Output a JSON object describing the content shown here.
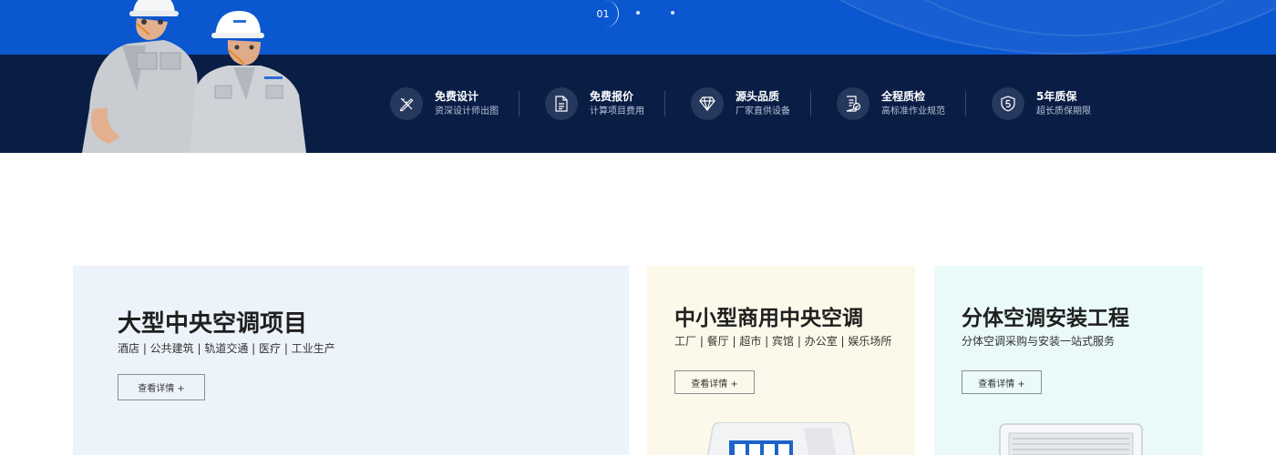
{
  "hero": {
    "slide_current": "01"
  },
  "features": [
    {
      "icon": "pen-ruler-icon",
      "title": "免费设计",
      "subtitle": "资深设计师出图"
    },
    {
      "icon": "document-icon",
      "title": "免费报价",
      "subtitle": "计算项目费用"
    },
    {
      "icon": "diamond-icon",
      "title": "源头品质",
      "subtitle": "厂家直供设备"
    },
    {
      "icon": "checklist-icon",
      "title": "全程质检",
      "subtitle": "高标准作业规范"
    },
    {
      "icon": "shield-5-icon",
      "title": "5年质保",
      "subtitle": "超长质保期限"
    }
  ],
  "cards": [
    {
      "title": "大型中央空调项目",
      "subtitle": "酒店 | 公共建筑 | 轨道交通 | 医疗 | 工业生产",
      "button": "查看详情 +",
      "background": "#edf3fb"
    },
    {
      "title": "中小型商用中央空调",
      "subtitle": "工厂 | 餐厅 | 超市 | 宾馆 | 办公室 | 娱乐场所",
      "button": "查看详情 +",
      "background": "#fdf9ea"
    },
    {
      "title": "分体空调安装工程",
      "subtitle": "分体空调采购与安装一站式服务",
      "button": "查看详情 +",
      "background": "#e9faf8"
    }
  ],
  "colors": {
    "hero_blue": "#0b57d0",
    "hero_navy": "#0a1d45",
    "feature_icon_bg": "#27385e"
  }
}
